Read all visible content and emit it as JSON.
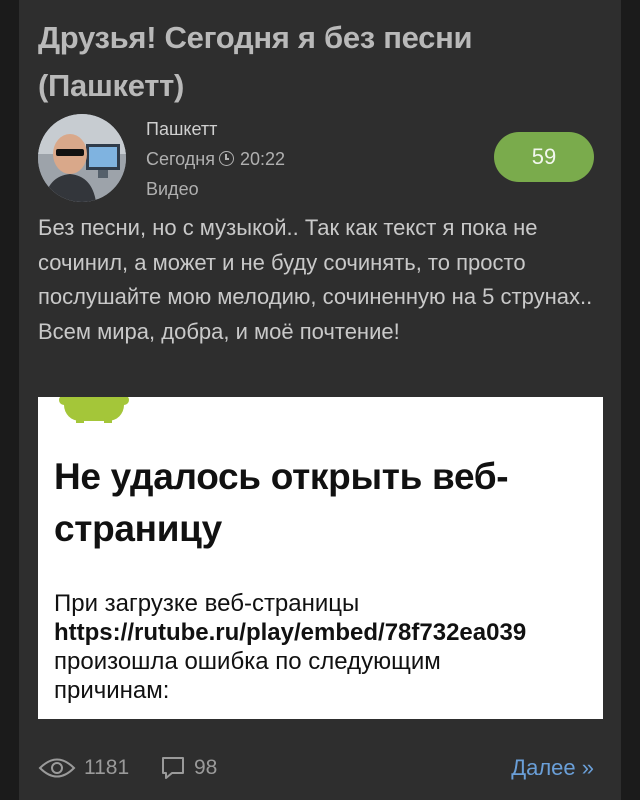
{
  "post": {
    "title": "Друзья! Сегодня я без песни (Пашкетт)",
    "author": "Пашкетт",
    "date": "Сегодня",
    "time": "20:22",
    "category": "Видео",
    "rating": "59",
    "text": "Без песни, но с музыкой.. Так как текст я пока не сочинил, а может и не буду сочинять, то просто послушайте мою мелодию, сочиненную на 5 струнах.. Всем мира, добра, и моё почтение!"
  },
  "embed": {
    "error_title": "Не удалось открыть веб-страницу",
    "line1": "При загрузке веб-страницы",
    "url": "https://rutube.ru/play/embed/78f732ea039",
    "line2": "произошла ошибка по следующим",
    "line3": "причинам:"
  },
  "footer": {
    "views": "1181",
    "comments": "98",
    "more_label": "Далее »"
  },
  "icons": {
    "views": "eye-icon",
    "comments": "comment-icon",
    "time": "clock-icon",
    "embed": "android-icon"
  },
  "colors": {
    "background": "#2e2e2e",
    "rating_badge": "#7aab4c",
    "link": "#6a9fd8",
    "android_green": "#a4c639"
  }
}
